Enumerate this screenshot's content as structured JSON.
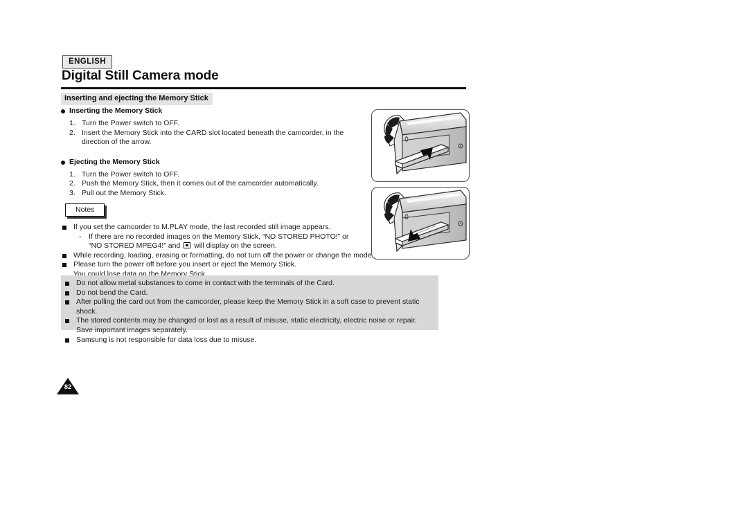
{
  "header": {
    "language_badge": "ENGLISH",
    "title": "Digital Still Camera mode"
  },
  "section": {
    "bar_title": "Inserting and ejecting the Memory Stick"
  },
  "inserting": {
    "heading": "Inserting the Memory Stick",
    "steps": [
      {
        "num": "1.",
        "text": "Turn the Power switch to OFF."
      },
      {
        "num": "2.",
        "text": "Insert the Memory Stick into the CARD slot located beneath the camcorder, in the direction of the arrow."
      }
    ]
  },
  "ejecting": {
    "heading": "Ejecting the Memory Stick",
    "steps": [
      {
        "num": "1.",
        "text": "Turn the Power switch to OFF."
      },
      {
        "num": "2.",
        "text": "Push the Memory Stick, then it comes out of the camcorder automatically."
      },
      {
        "num": "3.",
        "text": "Pull out the Memory Stick."
      }
    ]
  },
  "notes": {
    "label": "Notes",
    "item_1": "If you set the camcorder to M.PLAY mode, the last recorded still image appears.",
    "item_1_sub_dash": "-",
    "item_1_sub_line1": "If there are no recorded images on the Memory Stick, “NO STORED PHOTO!” or",
    "item_1_sub_line2_pre": "“NO STORED MPEG4!” and",
    "item_1_sub_line2_post": "will display on the screen.",
    "lcd_icon_name": "lcd-display-icon",
    "item_2": "While recording, loading, erasing or formatting, do not turn off the power or change the mode.",
    "item_3": "Please turn the power off before you insert or eject the Memory Stick.",
    "item_3_cont": "You could lose data on the Memory Stick."
  },
  "caution": {
    "item_1": "Do not allow metal substances to come in contact with the terminals of the Card.",
    "item_2": "Do not bend the Card.",
    "item_3": "After pulling the card out from the camcorder, please keep the Memory Stick in a soft case to prevent static shock.",
    "item_4": "The stored contents may be changed or lost as a result of misuse, static electricity, electric noise or repair.",
    "item_4_cont": "Save important images separately.",
    "item_5": "Samsung is not responsible for data loss due to misuse."
  },
  "footer": {
    "page_number": "82"
  },
  "illustrations": {
    "insert": {
      "name": "camcorder-insert-memory-stick-illustration",
      "arrow_direction": "up-right"
    },
    "eject": {
      "name": "camcorder-eject-memory-stick-illustration",
      "arrow_direction": "down-left"
    }
  },
  "colors": {
    "rule": "#111111",
    "section_bar_bg": "#e3e3e3",
    "caution_bg": "#d8d8d8",
    "badge_bg": "#e8e8e8"
  }
}
